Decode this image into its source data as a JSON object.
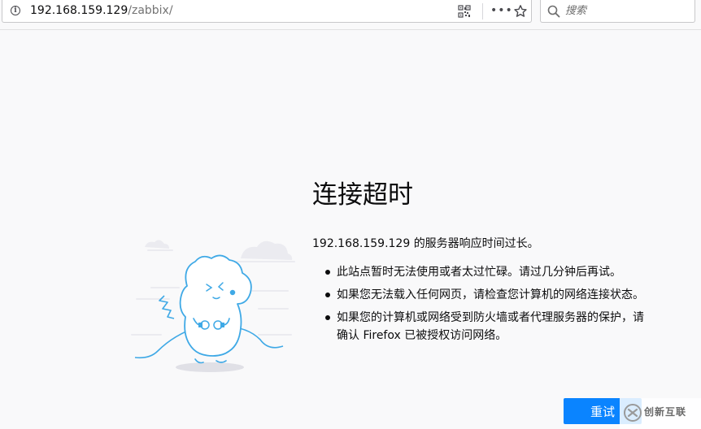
{
  "toolbar": {
    "url_host": "192.168.159.129",
    "url_path": "/zabbix/",
    "icons": [
      "info-icon",
      "qr-code-icon",
      "more-icon",
      "bookmark-star-icon",
      "search-icon"
    ],
    "more_glyph": "•••",
    "search_placeholder": "搜索"
  },
  "error": {
    "title": "连接超时",
    "description": "192.168.159.129 的服务器响应时间过长。",
    "bullets": [
      "此站点暂时无法使用或者太过忙碌。请过几分钟后再试。",
      "如果您无法载入任何网页，请检查您计算机的网络连接状态。",
      "如果您的计算机或网络受到防火墙或者代理服务器的保护，请确认 Firefox 已被授权访问网络。"
    ],
    "retry_label": "重试",
    "accent_color": "#0a84ff"
  },
  "watermark": {
    "text": "创新互联"
  }
}
